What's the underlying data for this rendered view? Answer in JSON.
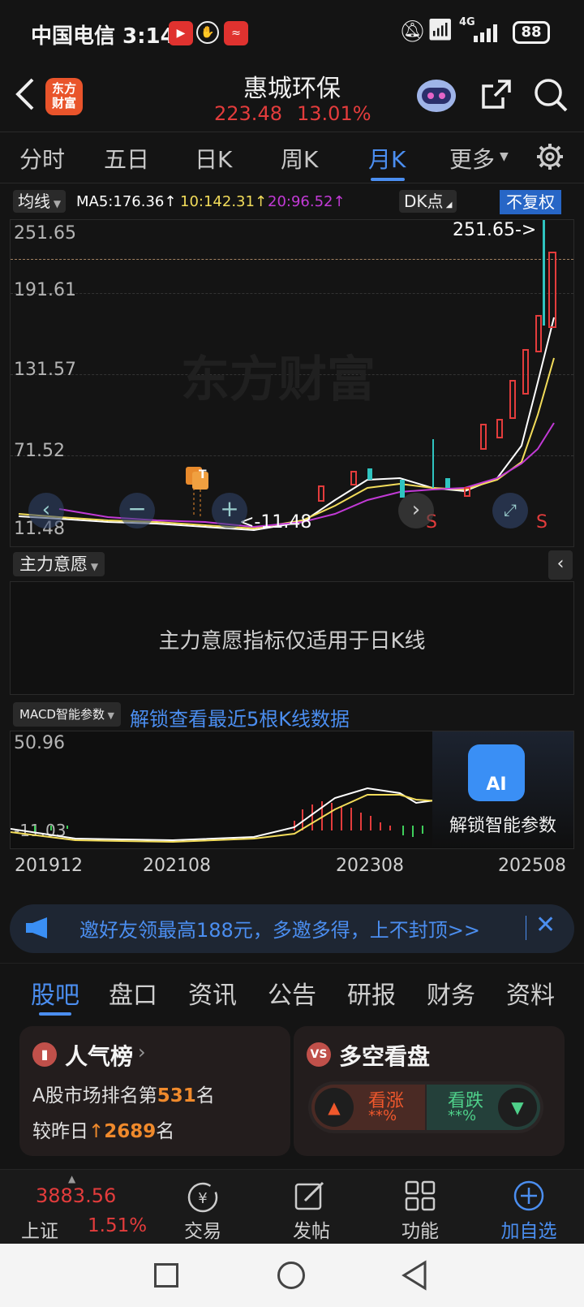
{
  "status_bar": {
    "carrier_time": "中国电信 3:14",
    "battery": "88",
    "network": "4G"
  },
  "header": {
    "back_icon": "back-arrow-icon",
    "logo_text": "东方\n财富",
    "stock_name": "惠城环保",
    "price": "223.48",
    "change_pct": "13.01%"
  },
  "period_tabs": [
    "分时",
    "五日",
    "日K",
    "周K",
    "月K",
    "更多"
  ],
  "active_period": "月K",
  "ma": {
    "button": "均线",
    "ma5": "MA5:176.36↑",
    "ma10": "10:142.31↑",
    "ma20": "20:96.52↑",
    "dk": "DK点",
    "adjust": "不复权"
  },
  "kline": {
    "y_ticks": [
      "251.65",
      "191.61",
      "131.57",
      "71.52",
      "11.48"
    ],
    "max_label": "251.65->",
    "min_label": "<-11.48",
    "watermark": "东方财富",
    "marker_t": "T",
    "marker_s": "S"
  },
  "main_force": {
    "title": "主力意愿",
    "message": "主力意愿指标仅适用于日K线"
  },
  "macd": {
    "title": "MACD智能参数",
    "unlock_text": "解锁查看最近5根K线数据",
    "top_value": "50.96",
    "bottom_value": "-11.03",
    "ai_label": "AI",
    "ai_unlock": "解锁智能参数",
    "dates": [
      "201912",
      "202108",
      "202308",
      "202508"
    ]
  },
  "invite": {
    "text": "邀好友领最高188元，多邀多得，上不封顶>>"
  },
  "content_tabs": [
    "股吧",
    "盘口",
    "资讯",
    "公告",
    "研报",
    "财务",
    "资料"
  ],
  "active_content_tab": "股吧",
  "popularity_card": {
    "title": "人气榜",
    "rank_prefix": "A股市场排名第",
    "rank": "531",
    "rank_suffix": "名",
    "change_prefix": "较昨日",
    "change_value": "2689",
    "change_suffix": "名"
  },
  "bull_bear_card": {
    "title": "多空看盘",
    "bull_label": "看涨",
    "bull_value": "**%",
    "bear_label": "看跌",
    "bear_value": "**%"
  },
  "bottom_nav": {
    "index_value": "3883.56",
    "index_name": "上证",
    "index_pct": "1.51%",
    "trade": "交易",
    "post": "发帖",
    "function": "功能",
    "add_watch": "加自选"
  },
  "colors": {
    "up": "#e33c3c",
    "down": "#2fc4c0",
    "accent": "#4b8ef0",
    "ma5": "#ffffff",
    "ma10": "#f2dc5a",
    "ma20": "#c23ad6"
  }
}
